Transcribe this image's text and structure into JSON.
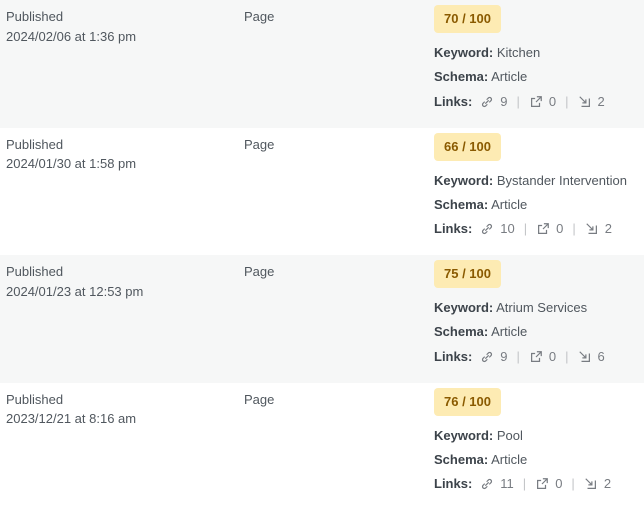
{
  "labels": {
    "keyword": "Keyword:",
    "schema": "Schema:",
    "links": "Links:"
  },
  "icons": {
    "internal": "link-icon",
    "external": "external-link-icon",
    "incoming": "incoming-link-icon"
  },
  "colors": {
    "score_bg": "#fdebb3",
    "score_text": "#8a5a00",
    "alt_row": "#f6f7f7"
  },
  "rows": [
    {
      "status": "Published",
      "date": "2024/02/06 at 1:36 pm",
      "type": "Page",
      "score": "70 / 100",
      "keyword": "Kitchen",
      "schema": "Article",
      "links_internal": "9",
      "links_external": "0",
      "links_incoming": "2"
    },
    {
      "status": "Published",
      "date": "2024/01/30 at 1:58 pm",
      "type": "Page",
      "score": "66 / 100",
      "keyword": "Bystander Intervention",
      "schema": "Article",
      "links_internal": "10",
      "links_external": "0",
      "links_incoming": "2"
    },
    {
      "status": "Published",
      "date": "2024/01/23 at 12:53 pm",
      "type": "Page",
      "score": "75 / 100",
      "keyword": "Atrium Services",
      "schema": "Article",
      "links_internal": "9",
      "links_external": "0",
      "links_incoming": "6"
    },
    {
      "status": "Published",
      "date": "2023/12/21 at 8:16 am",
      "type": "Page",
      "score": "76 / 100",
      "keyword": "Pool",
      "schema": "Article",
      "links_internal": "11",
      "links_external": "0",
      "links_incoming": "2"
    }
  ]
}
